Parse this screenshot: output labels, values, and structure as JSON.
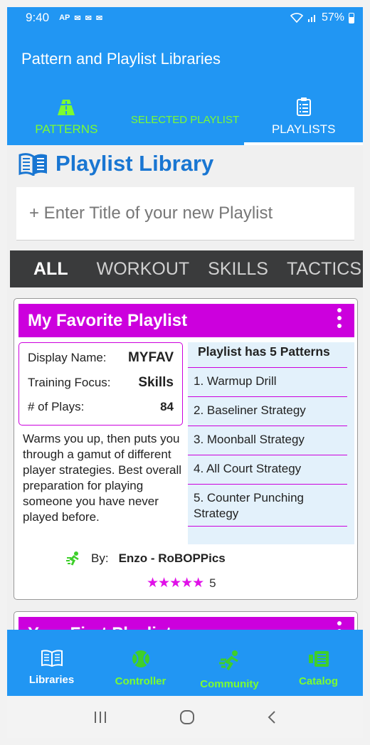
{
  "status": {
    "time": "9:40",
    "notifications": [
      "AP",
      "✉",
      "✉",
      "✉"
    ],
    "signal": "WiFi",
    "battery": "57%"
  },
  "appbar": {
    "title": "Pattern and Playlist Libraries",
    "tabs": [
      {
        "label": "PATTERNS",
        "icon": "road-icon"
      },
      {
        "label": "SELECTED PLAYLIST",
        "icon": ""
      },
      {
        "label": "PLAYLISTS",
        "icon": "clipboard-list-icon",
        "active": true
      }
    ]
  },
  "library": {
    "title": "Playlist Library",
    "new_playlist_placeholder": "+ Enter Title of your new Playlist"
  },
  "filters": [
    "ALL",
    "WORKOUT",
    "SKILLS",
    "TACTICS"
  ],
  "card": {
    "title": "My Favorite Playlist",
    "display_name_label": "Display Name:",
    "display_name": "MYFAV",
    "focus_label": "Training Focus:",
    "focus": "Skills",
    "plays_label": "# of Plays:",
    "plays": "84",
    "description": "Warms you up, then puts you through a gamut of different player strategies. Best overall preparation for playing someone you have never played before.",
    "patterns_header": "Playlist has 5 Patterns",
    "patterns": [
      "1. Warmup Drill",
      "2. Baseliner Strategy",
      "3. Moonball Strategy",
      "4. All Court Strategy",
      "5. Counter Punching Strategy"
    ],
    "by_label": "By:",
    "author": "Enzo - RoBOPPics",
    "stars": "★★★★★",
    "rating": "5"
  },
  "card2": {
    "title": "Your First Playlist"
  },
  "bottomnav": [
    {
      "label": "Libraries",
      "active": true
    },
    {
      "label": "Controller"
    },
    {
      "label": "Community"
    },
    {
      "label": "Catalog"
    }
  ],
  "colors": {
    "primary": "#2196f3",
    "accent": "#7cfc31",
    "card_header": "#cc00dd",
    "title_blue": "#1976d2"
  }
}
